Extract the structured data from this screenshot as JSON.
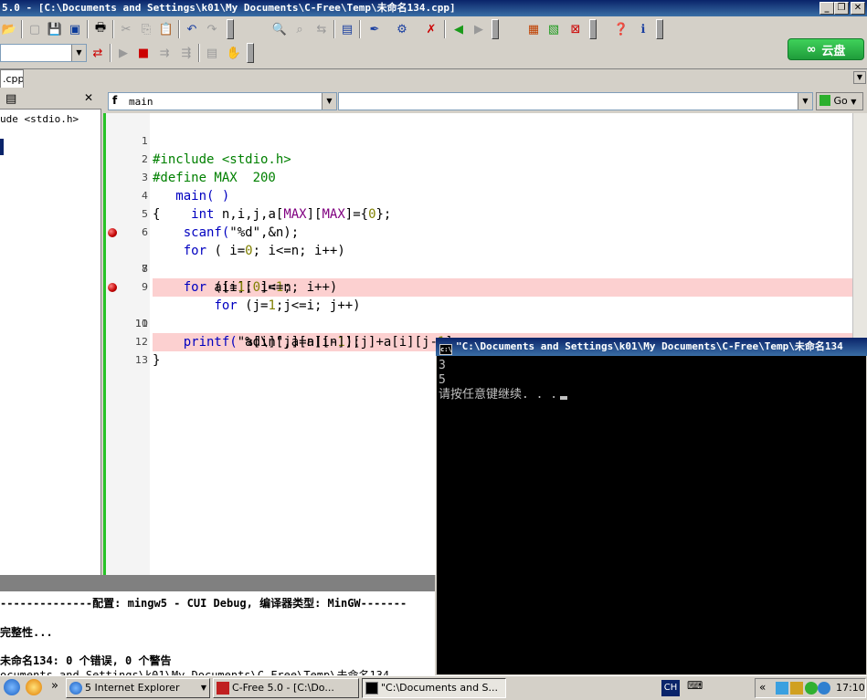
{
  "window": {
    "title": "5.0 - [C:\\Documents and Settings\\k01\\My Documents\\C-Free\\Temp\\未命名134.cpp]",
    "min_label": "_",
    "max_label": "❐",
    "close_label": "✕"
  },
  "toolbar": {
    "yunpan_label": "云盘"
  },
  "tabs": {
    "file_tab": ".cpp"
  },
  "left_panel": {
    "item": "ude <stdio.h>",
    "close_label": "✕"
  },
  "editor_toolbar": {
    "function_combo_value": "main",
    "function_combo_prefix": "f",
    "symbol_combo_value": "",
    "go_label": "Go"
  },
  "code": {
    "lines": [
      {
        "num": "1",
        "breakpoint": false
      },
      {
        "num": "2",
        "breakpoint": false
      },
      {
        "num": "3",
        "breakpoint": false
      },
      {
        "num": "4",
        "breakpoint": false
      },
      {
        "num": "5",
        "breakpoint": false
      },
      {
        "num": "6",
        "breakpoint": false
      },
      {
        "num": "7",
        "breakpoint": true
      },
      {
        "num": "8",
        "breakpoint": false
      },
      {
        "num": "9",
        "breakpoint": false
      },
      {
        "num": "10",
        "breakpoint": true
      },
      {
        "num": "11",
        "breakpoint": false
      },
      {
        "num": "12",
        "breakpoint": false
      },
      {
        "num": "13",
        "breakpoint": false
      }
    ],
    "l1_pp": "#include <stdio.h>",
    "l2_pp": "#define MAX  200",
    "l3": "   main( )",
    "l4_a": "{    ",
    "l4_kw": "int",
    "l4_b": " n,i,j,a[",
    "l4_id1": "MAX",
    "l4_c": "][",
    "l4_id2": "MAX",
    "l4_d": "]={",
    "l4_n": "0",
    "l4_e": "};",
    "l5_a": "    scanf(",
    "l5_s": "\"%d\"",
    "l5_b": ",&n);",
    "l6_a": "    ",
    "l6_kw": "for",
    "l6_b": " ( i=",
    "l6_n": "0",
    "l6_c": "; i<=n; i++)",
    "l7_a": "        a[i][",
    "l7_n1": "0",
    "l7_b": "]=",
    "l7_n2": "1",
    "l7_c": ";",
    "l8_a": "    ",
    "l8_kw": "for",
    "l8_b": " (i=",
    "l8_n": "1",
    "l8_c": "; i<=n; i++)",
    "l9_a": "        ",
    "l9_kw": "for",
    "l9_b": " (j=",
    "l9_n": "1",
    "l9_c": ";j<=i; j++)",
    "l10_a": "            a[i][j]=a[i-",
    "l10_n1": "1",
    "l10_b": "][j]+a[i][j-",
    "l10_n2": "1",
    "l10_c": "];",
    "l11_a": "    printf(",
    "l11_s": "\"%d\\n\"",
    "l11_b": ",a[n][n]);",
    "l12": "}",
    "l13": ""
  },
  "output": {
    "line1": "--------------配置: mingw5 - CUI Debug, 编译器类型: MinGW-------",
    "line2": "完整性...",
    "line3": "未命名134: 0 个错误, 0 个警告",
    "line4": "ocuments and Settings\\k01\\My Documents\\C-Free\\Temp\\未命名134"
  },
  "console": {
    "title": "\"C:\\Documents and Settings\\k01\\My Documents\\C-Free\\Temp\\未命名134",
    "line1": "3",
    "line2": "5",
    "line3": "请按任意键继续. . ."
  },
  "taskbar": {
    "overflow_label": "»",
    "ie_label": "5 Internet Explorer",
    "cfree_label": "C-Free 5.0 - [C:\\Do...",
    "console_label": "\"C:\\Documents and S...",
    "lang": "CH",
    "tray_overflow": "«",
    "clock": "17:10"
  }
}
